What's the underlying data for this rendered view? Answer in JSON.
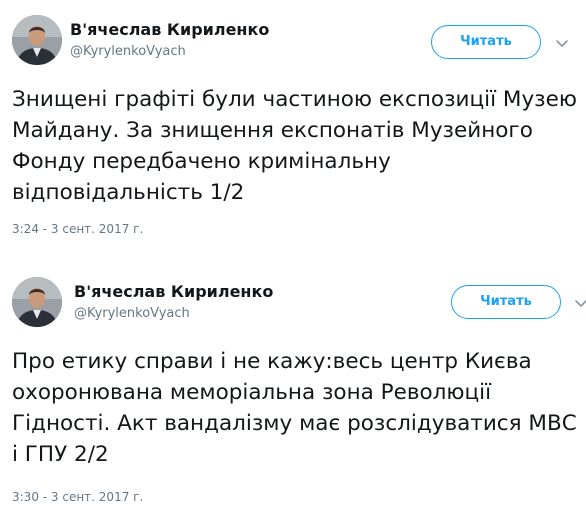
{
  "tweets": [
    {
      "author_name": "В'ячеслав Кириленко",
      "author_handle": "@KyrylenkoVyach",
      "follow_label": "Читать",
      "text": "Знищені графіті були частиною експозиції Музею Майдану. За знищення експонатів Музейного Фонду передбачено кримінальну відповідальність 1/2",
      "timestamp": "3:24 - 3 сент. 2017 г.",
      "avatar_icon": "person-photo-icon",
      "menu_icon": "chevron-down-icon"
    },
    {
      "author_name": "В'ячеслав Кириленко",
      "author_handle": "@KyrylenkoVyach",
      "follow_label": "Читать",
      "text": "Про етику справи і не кажу:весь центр Києва охоронювана меморіальна зона Революції Гідності. Акт вандалізму має розслідуватися МВС і ГПУ 2/2",
      "timestamp": "3:30 - 3 сент. 2017 г.",
      "avatar_icon": "person-photo-icon",
      "menu_icon": "chevron-down-icon"
    }
  ],
  "colors": {
    "accent": "#1da1f2",
    "text": "#14171a",
    "secondary_text": "#657786"
  }
}
